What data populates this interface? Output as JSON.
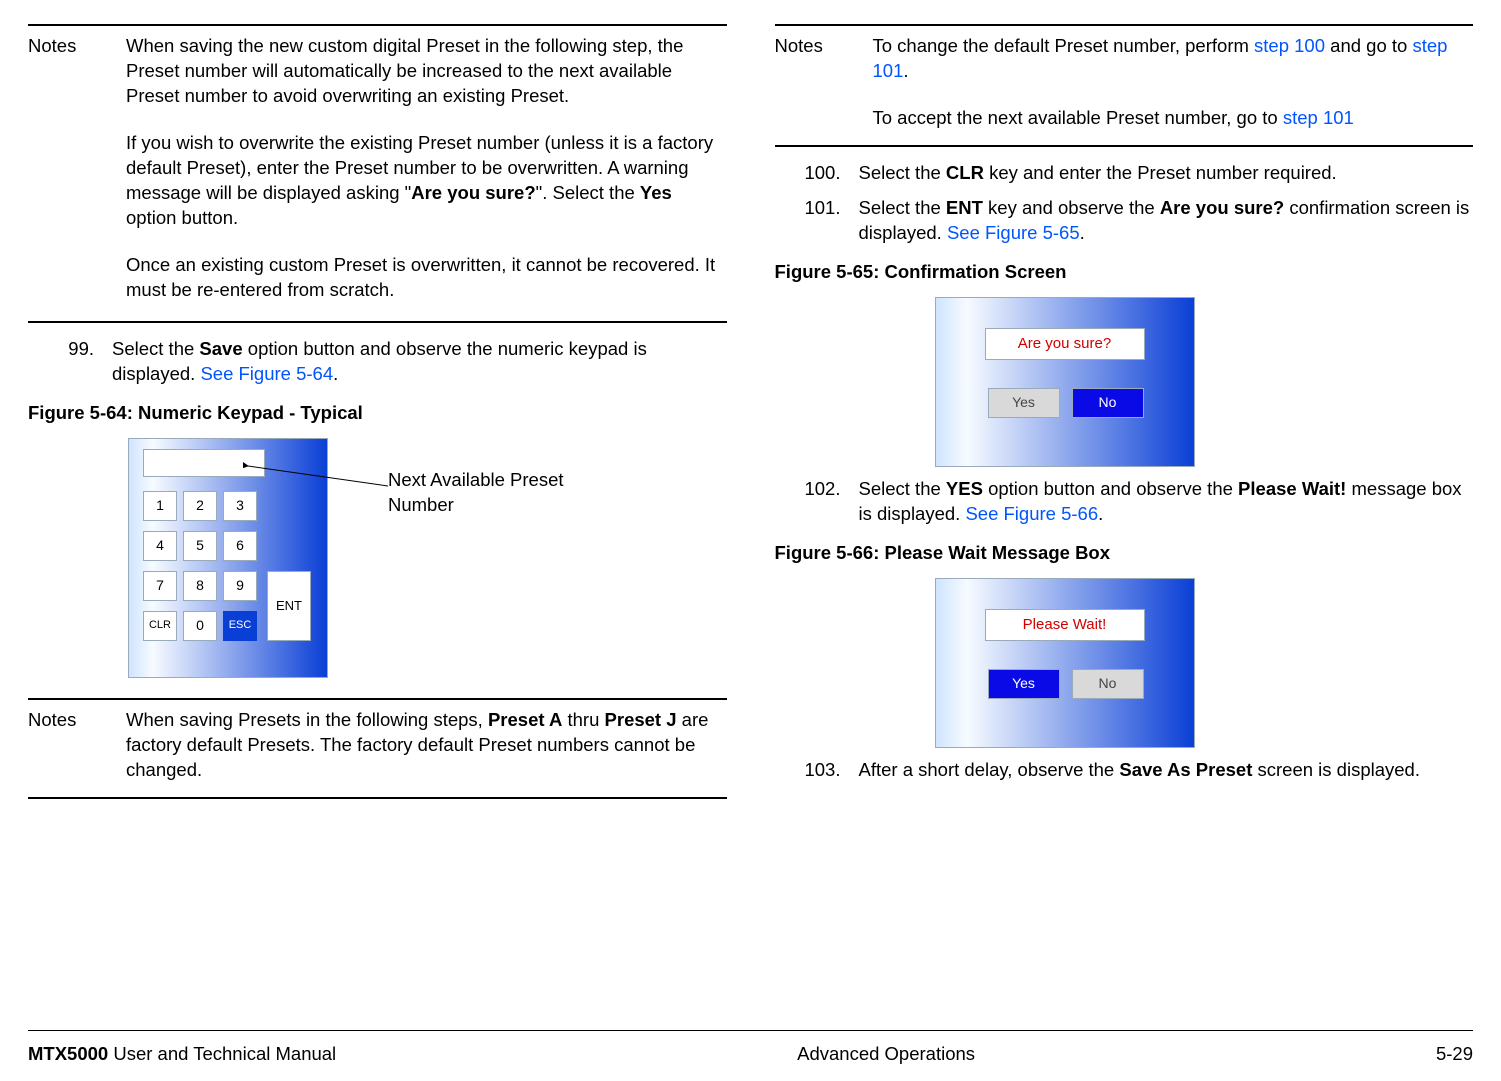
{
  "col1": {
    "notes1": {
      "label": "Notes",
      "p1a": "When saving the new custom digital Preset in the following step, the Preset number will automatically be increased to the next available Preset number to avoid overwriting an existing Preset.",
      "p2_pre": "If you wish to overwrite the existing Preset number (unless it is a factory default Preset), enter the Preset number to be overwritten.  A warning message will be displayed asking \"",
      "p2_bold1": "Are you sure?",
      "p2_mid": "\".  Select the ",
      "p2_bold2": "Yes",
      "p2_post": " option button.",
      "p3": "Once an existing custom Preset is overwritten, it cannot be recovered.  It must be re-entered from scratch."
    },
    "step99": {
      "num": "99.",
      "t1": "Select the ",
      "b1": "Save",
      "t2": " option button and observe the numeric keypad is displayed.  ",
      "link": "See Figure 5-64",
      "t3": "."
    },
    "fig64": {
      "caption": "Figure 5-64:   Numeric Keypad - Typical",
      "annot": "Next Available Preset Number",
      "keys": {
        "k1": "1",
        "k2": "2",
        "k3": "3",
        "k4": "4",
        "k5": "5",
        "k6": "6",
        "k7": "7",
        "k8": "8",
        "k9": "9",
        "k0": "0",
        "clr": "CLR",
        "esc": "ESC",
        "ent": "ENT"
      }
    },
    "notes2": {
      "label": "Notes",
      "t1": "When saving Presets in the following steps, ",
      "b1": "Preset A",
      "t2": " thru ",
      "b2": "Preset J",
      "t3": " are factory default Presets.  The factory default Preset numbers cannot be changed."
    }
  },
  "col2": {
    "notes3": {
      "label": "Notes",
      "p1_t1": "To change the default Preset number, perform ",
      "p1_l1": "step 100",
      "p1_t2": " and go to ",
      "p1_l2": "step 101",
      "p1_t3": ".",
      "p2_t1": "To accept the next available Preset number, go to ",
      "p2_l1": "step 101"
    },
    "step100": {
      "num": "100.",
      "t1": "Select the ",
      "b1": "CLR",
      "t2": " key and enter the Preset number required."
    },
    "step101": {
      "num": "101.",
      "t1": "Select the ",
      "b1": "ENT",
      "t2": " key and observe the ",
      "b2": "Are you sure?",
      "t3": " confirmation screen is displayed.  ",
      "link": "See Figure 5-65",
      "t4": "."
    },
    "fig65": {
      "caption": "Figure 5-65:   Confirmation Screen",
      "msg": "Are you sure?",
      "yes": "Yes",
      "no": "No"
    },
    "step102": {
      "num": "102.",
      "t1": "Select the ",
      "b1": "YES",
      "t2": " option button and observe the ",
      "b2": "Please Wait!",
      "t3": " message box is displayed.  ",
      "link": "See Figure 5-66",
      "t4": "."
    },
    "fig66": {
      "caption": "Figure 5-66:   Please Wait Message Box",
      "msg": "Please Wait!",
      "yes": "Yes",
      "no": "No"
    },
    "step103": {
      "num": "103.",
      "t1": "After a short delay, observe the ",
      "b1": "Save As Preset",
      "t2": " screen is displayed."
    }
  },
  "footer": {
    "left_bold": "MTX5000",
    "left_rest": " User and Technical Manual",
    "center": "Advanced Operations",
    "right": "5-29"
  }
}
